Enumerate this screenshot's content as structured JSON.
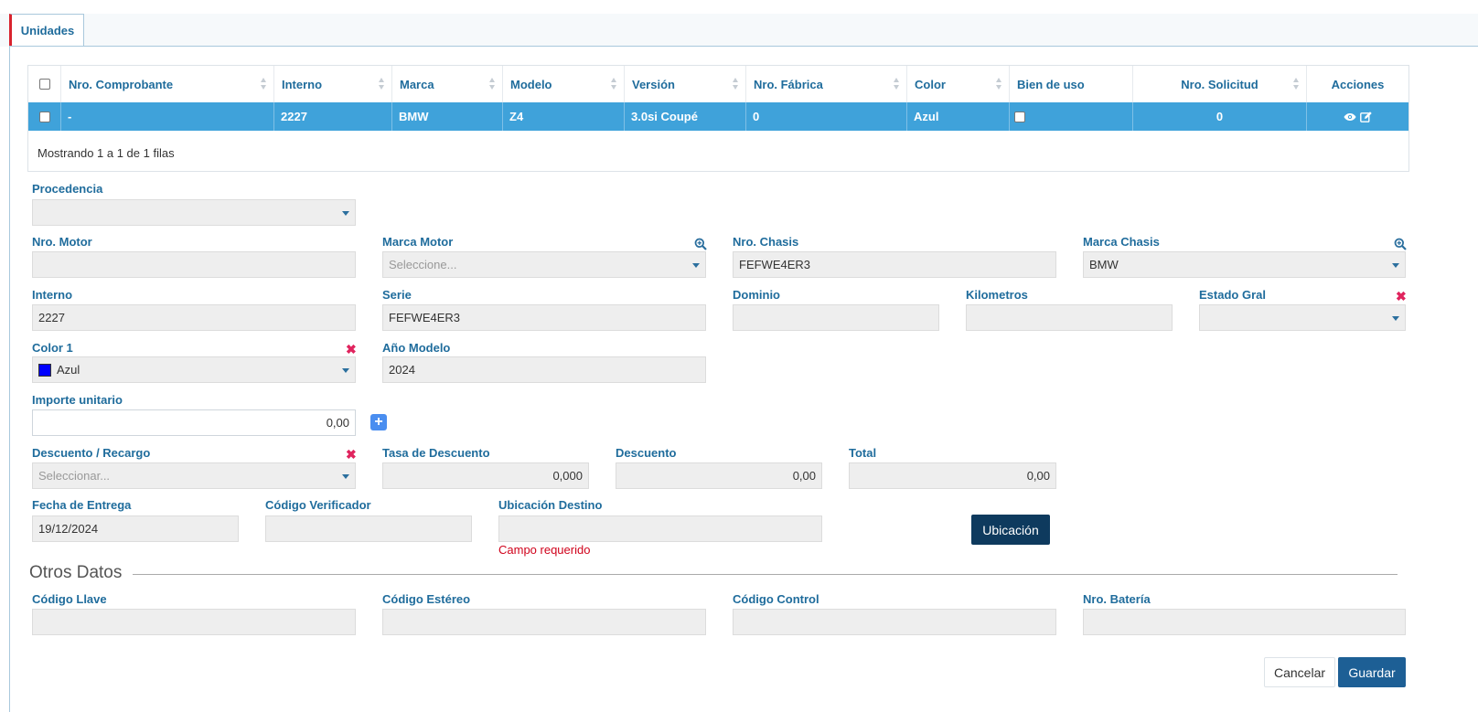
{
  "tab": {
    "label": "Unidades"
  },
  "table": {
    "columns": [
      "Nro. Comprobante",
      "Interno",
      "Marca",
      "Modelo",
      "Versión",
      "Nro. Fábrica",
      "Color",
      "Bien de uso",
      "Nro. Solicitud",
      "Acciones"
    ],
    "row": {
      "comprobante": "-",
      "interno": "2227",
      "marca": "BMW",
      "modelo": "Z4",
      "version": "3.0si Coupé",
      "fabrica": "0",
      "color": "Azul",
      "solicitud": "0"
    },
    "footer": "Mostrando 1 a 1 de 1 filas"
  },
  "form": {
    "procedencia": {
      "label": "Procedencia",
      "value": ""
    },
    "nro_motor": {
      "label": "Nro. Motor",
      "value": ""
    },
    "marca_motor": {
      "label": "Marca Motor",
      "placeholder": "Seleccione..."
    },
    "nro_chasis": {
      "label": "Nro. Chasis",
      "value": "FEFWE4ER3"
    },
    "marca_chasis": {
      "label": "Marca Chasis",
      "value": "BMW"
    },
    "interno": {
      "label": "Interno",
      "value": "2227"
    },
    "serie": {
      "label": "Serie",
      "value": "FEFWE4ER3"
    },
    "dominio": {
      "label": "Dominio",
      "value": ""
    },
    "kilometros": {
      "label": "Kilometros",
      "value": ""
    },
    "estado_gral": {
      "label": "Estado Gral",
      "value": ""
    },
    "color1": {
      "label": "Color 1",
      "value": "Azul",
      "swatch": "#0000ff"
    },
    "anio_modelo": {
      "label": "Año Modelo",
      "value": "2024"
    },
    "importe": {
      "label": "Importe unitario",
      "value": "0,00"
    },
    "descuento_recargo": {
      "label": "Descuento / Recargo",
      "placeholder": "Seleccionar..."
    },
    "tasa_descuento": {
      "label": "Tasa de Descuento",
      "value": "0,000"
    },
    "descuento": {
      "label": "Descuento",
      "value": "0,00"
    },
    "total": {
      "label": "Total",
      "value": "0,00"
    },
    "fecha_entrega": {
      "label": "Fecha de Entrega",
      "value": "19/12/2024"
    },
    "codigo_verificador": {
      "label": "Código Verificador",
      "value": ""
    },
    "ubicacion_destino": {
      "label": "Ubicación Destino",
      "value": "",
      "error": "Campo requerido"
    },
    "ubicacion_button": "Ubicación"
  },
  "otros": {
    "title": "Otros Datos",
    "codigo_llave": {
      "label": "Código Llave",
      "value": ""
    },
    "codigo_estereo": {
      "label": "Código Estéreo",
      "value": ""
    },
    "codigo_control": {
      "label": "Código Control",
      "value": ""
    },
    "nro_bateria": {
      "label": "Nro. Batería",
      "value": ""
    }
  },
  "actions": {
    "cancel": "Cancelar",
    "save": "Guardar"
  },
  "colors": {
    "accent": "#1f6c9c",
    "row_selected": "#3fa2da",
    "error": "#d0021b",
    "tab_marker": "#d9232e"
  }
}
